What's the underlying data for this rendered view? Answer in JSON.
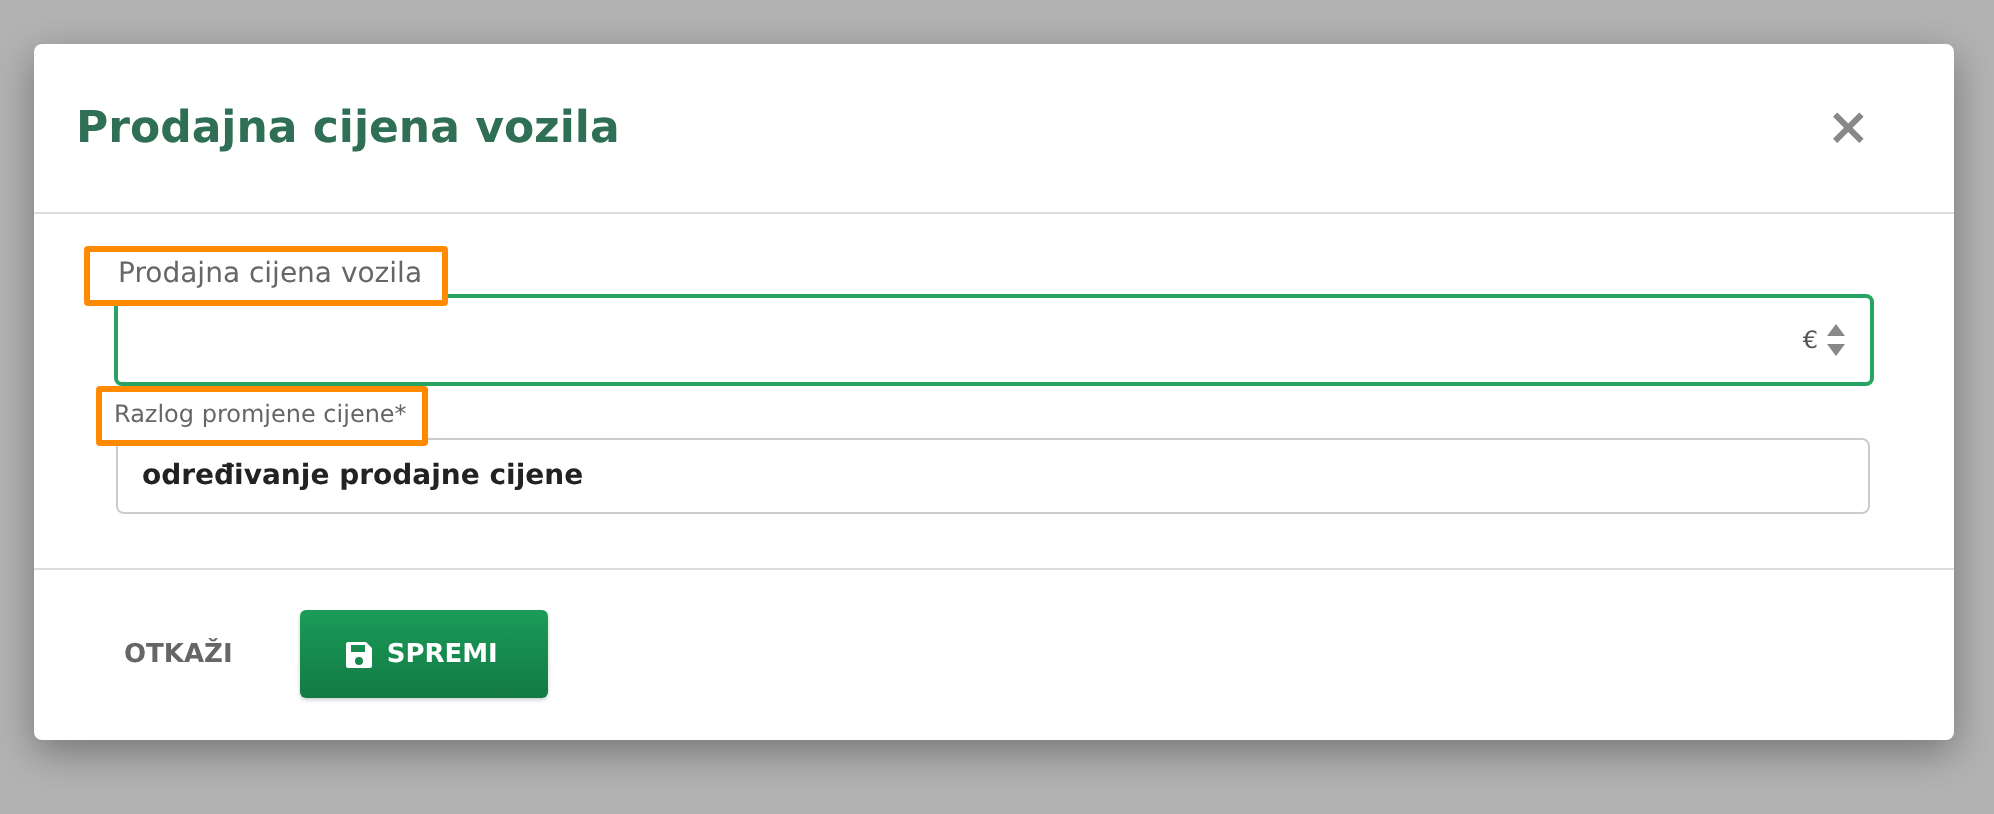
{
  "dialog": {
    "title": "Prodajna cijena vozila",
    "close": "×"
  },
  "fields": [
    {
      "kind": "number",
      "label": "Prodajna cijena vozila",
      "highlighted": true,
      "focused": true,
      "unit": "€"
    },
    {
      "kind": "text",
      "label": "Razlog promjene cijene*",
      "highlighted": true,
      "focused": false,
      "value": "određivanje prodajne cijene"
    }
  ],
  "buttons": [
    {
      "kind": "flat",
      "label": "OTKAŽI"
    },
    {
      "kind": "primary",
      "label": "SPREMI"
    }
  ]
}
